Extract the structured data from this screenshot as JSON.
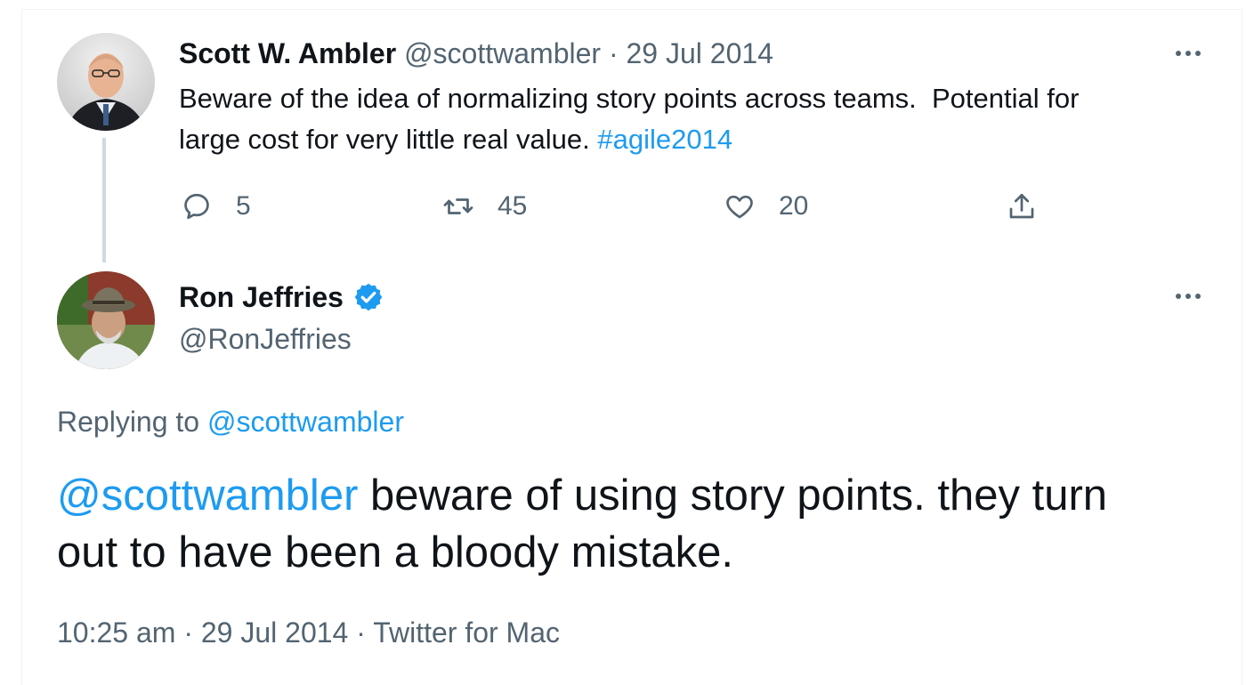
{
  "parent_tweet": {
    "author_name": "Scott W. Ambler",
    "handle": "@scottwambler",
    "separator": "·",
    "date": "29 Jul 2014",
    "text_line1": "Beware of the idea of normalizing story points across teams.  Potential for",
    "text_line2": "large cost for very little real value.",
    "hashtag": "#agile2014",
    "actions": {
      "reply_count": "5",
      "retweet_count": "45",
      "like_count": "20"
    },
    "icons": [
      "reply-icon",
      "retweet-icon",
      "like-icon",
      "share-icon",
      "more-icon"
    ]
  },
  "main_tweet": {
    "author_name": "Ron Jeffries",
    "verified": true,
    "handle": "@RonJeffries",
    "replying_label": "Replying to",
    "replying_handle": "@scottwambler",
    "mention": "@scottwambler",
    "text_line1_rest": "beware of using story points. they turn",
    "text_line2": "out to have been a bloody mistake.",
    "time": "10:25 am",
    "sep1": "·",
    "date": "29 Jul 2014",
    "sep2": "·",
    "client": "Twitter for Mac"
  },
  "colors": {
    "link": "#1d9bf0",
    "muted": "#536471",
    "text": "#0f1419",
    "verified": "#1d9bf0"
  }
}
